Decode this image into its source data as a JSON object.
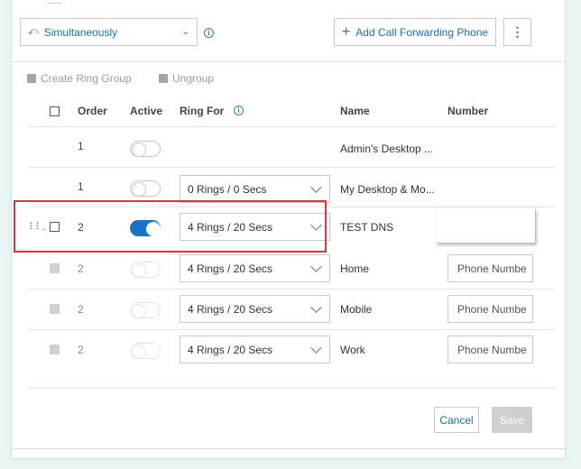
{
  "ring_mode": {
    "label": "Simultaneously",
    "icon": "ring-simultaneous-icon"
  },
  "add_forwarding_label": "Add Call Forwarding Phone",
  "toolbar": {
    "create_group": "Create Ring Group",
    "ungroup": "Ungroup"
  },
  "columns": {
    "order": "Order",
    "active": "Active",
    "ring_for": "Ring For",
    "name": "Name",
    "number": "Number"
  },
  "rows": [
    {
      "order": "1",
      "active": false,
      "ring_for": "",
      "name": "Admin's Desktop ...",
      "number": ""
    },
    {
      "order": "1",
      "active": false,
      "ring_for": "0 Rings / 0 Secs",
      "name": "My Desktop & Mo...",
      "number": ""
    },
    {
      "order": "2",
      "active": true,
      "ring_for": "4 Rings / 20 Secs",
      "name": "TEST DNS",
      "number": ""
    },
    {
      "order": "2",
      "active": false,
      "ring_for": "4 Rings / 20 Secs",
      "name": "Home",
      "number_placeholder": "Phone Numbe"
    },
    {
      "order": "2",
      "active": false,
      "ring_for": "4 Rings / 20 Secs",
      "name": "Mobile",
      "number_placeholder": "Phone Numbe"
    },
    {
      "order": "2",
      "active": false,
      "ring_for": "4 Rings / 20 Secs",
      "name": "Work",
      "number_placeholder": "Phone Numbe"
    }
  ],
  "actions": {
    "cancel": "Cancel",
    "save": "Save"
  },
  "colors": {
    "accent": "#1f6eb6",
    "toggle_on": "#1a73c7",
    "highlight": "#d9373a",
    "background": "#e6f5f3"
  }
}
